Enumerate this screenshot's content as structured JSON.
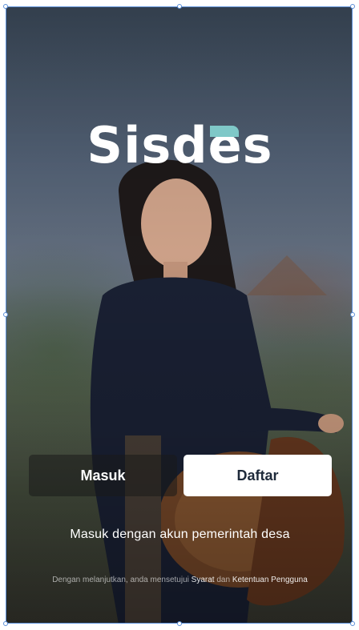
{
  "brand": {
    "logo_text": "Sisdes",
    "mark_color": "#7fc8c8"
  },
  "actions": {
    "login_label": "Masuk",
    "register_label": "Daftar"
  },
  "subtitle": "Masuk dengan akun pemerintah desa",
  "terms": {
    "prefix": "Dengan melanjutkan, anda mensetujui ",
    "terms_link": "Syarat",
    "conjunction": " dan ",
    "policy_link": "Ketentuan Pengguna"
  },
  "colors": {
    "artboard_border": "#5b8fd8",
    "primary_button": "#ffffff",
    "button_text_dark": "#1e2a3a"
  }
}
